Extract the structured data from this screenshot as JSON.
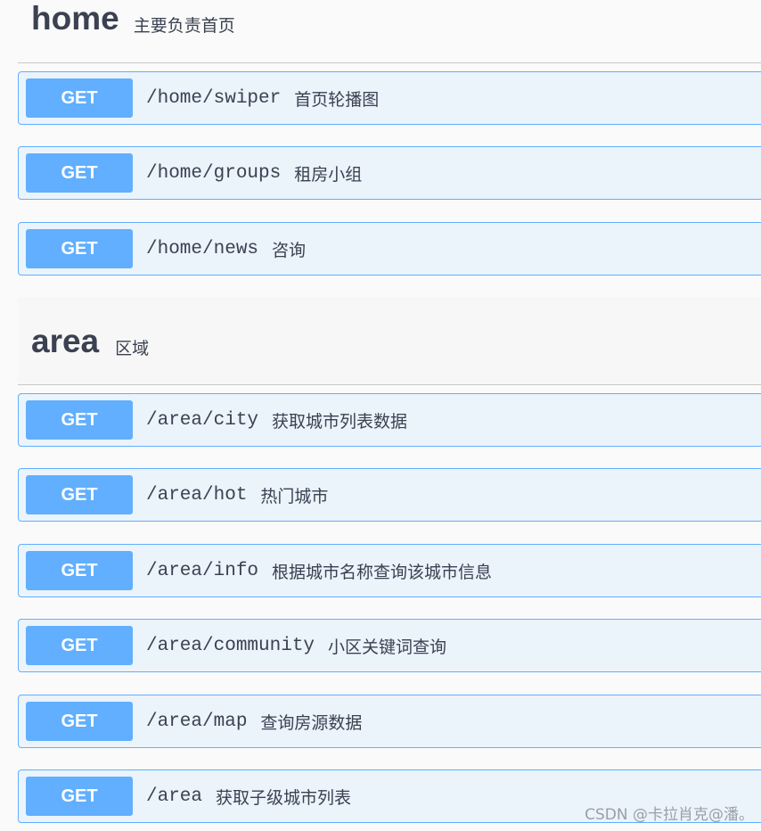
{
  "sections": [
    {
      "name": "home",
      "description": "主要负责首页",
      "operations": [
        {
          "method": "GET",
          "path": "/home/swiper",
          "summary": "首页轮播图"
        },
        {
          "method": "GET",
          "path": "/home/groups",
          "summary": "租房小组"
        },
        {
          "method": "GET",
          "path": "/home/news",
          "summary": "咨询"
        }
      ]
    },
    {
      "name": "area",
      "description": "区域",
      "operations": [
        {
          "method": "GET",
          "path": "/area/city",
          "summary": "获取城市列表数据"
        },
        {
          "method": "GET",
          "path": "/area/hot",
          "summary": "热门城市"
        },
        {
          "method": "GET",
          "path": "/area/info",
          "summary": "根据城市名称查询该城市信息"
        },
        {
          "method": "GET",
          "path": "/area/community",
          "summary": "小区关键词查询"
        },
        {
          "method": "GET",
          "path": "/area/map",
          "summary": "查询房源数据"
        },
        {
          "method": "GET",
          "path": "/area",
          "summary": "获取子级城市列表"
        }
      ]
    }
  ],
  "watermark": "CSDN @卡拉肖克@潘。",
  "colors": {
    "get_method": "#61affe",
    "get_background": "#ebf3fb",
    "text": "#3b4151"
  }
}
